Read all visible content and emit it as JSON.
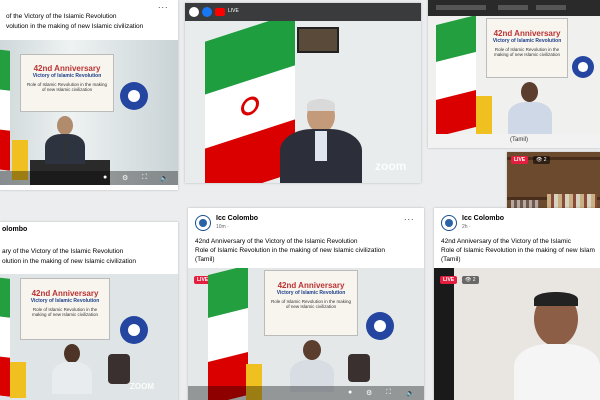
{
  "post_top_left": {
    "line1": "of the Victory of the Islamic Revolution",
    "line2": "volution in the making of new Islamic civilization",
    "banner": {
      "title": "42nd Anniversary",
      "subtitle": "Victory of Islamic Revolution",
      "theme": "Role of Islamic Revolution in the making of new Islamic civilization"
    },
    "more": "..."
  },
  "post_top_center": {
    "zoom_label": "zoom",
    "toolbar_text": "LIVE"
  },
  "post_top_right": {
    "banner": {
      "title": "42nd Anniversary",
      "subtitle": "Victory of Islamic Revolution",
      "theme": "Role of Islamic Revolution in the making of new Islamic civilization"
    },
    "caption": "(Tamil)"
  },
  "post_bottom_left": {
    "page_name": "olombo",
    "line1": "ary of the Victory of the Islamic Revolution",
    "line2": "olution in the making of new Islamic civilization",
    "banner": {
      "title": "42nd Anniversary",
      "subtitle": "Victory of Islamic Revolution",
      "theme": "Role of Islamic Revolution in the making of new Islamic civilization"
    },
    "zoom_label": "ZOOM"
  },
  "post_bottom_center": {
    "page_name": "Icc Colombo",
    "time": "10m · ",
    "more": "...",
    "line1": "42nd Anniversary of the Victory of the Islamic Revolution",
    "line2": "Role of Islamic Revolution in the making of new Islamic civilization",
    "line3": "(Tamil)",
    "live": "LIVE",
    "viewers": "👁 1",
    "banner": {
      "title": "42nd Anniversary",
      "subtitle": "Victory of Islamic Revolution",
      "theme": "Role of Islamic Revolution in the making of new Islamic civilization"
    }
  },
  "post_bottom_right": {
    "page_name": "Icc Colombo",
    "time": "2h · ",
    "line1": "42nd Anniversary of the Victory of the Islamic",
    "line2": "Role of Islamic Revolution in the making of new Islam",
    "line3": "(Tamil)",
    "live": "LIVE",
    "viewers": "👁 2"
  },
  "inset_bookshelf": {
    "live": "LIVE",
    "viewers": "👁 2"
  },
  "colors": {
    "iran_green": "#239f40",
    "iran_red": "#da0000",
    "fb_blue": "#1877f2",
    "live_red": "#e41e3f"
  }
}
